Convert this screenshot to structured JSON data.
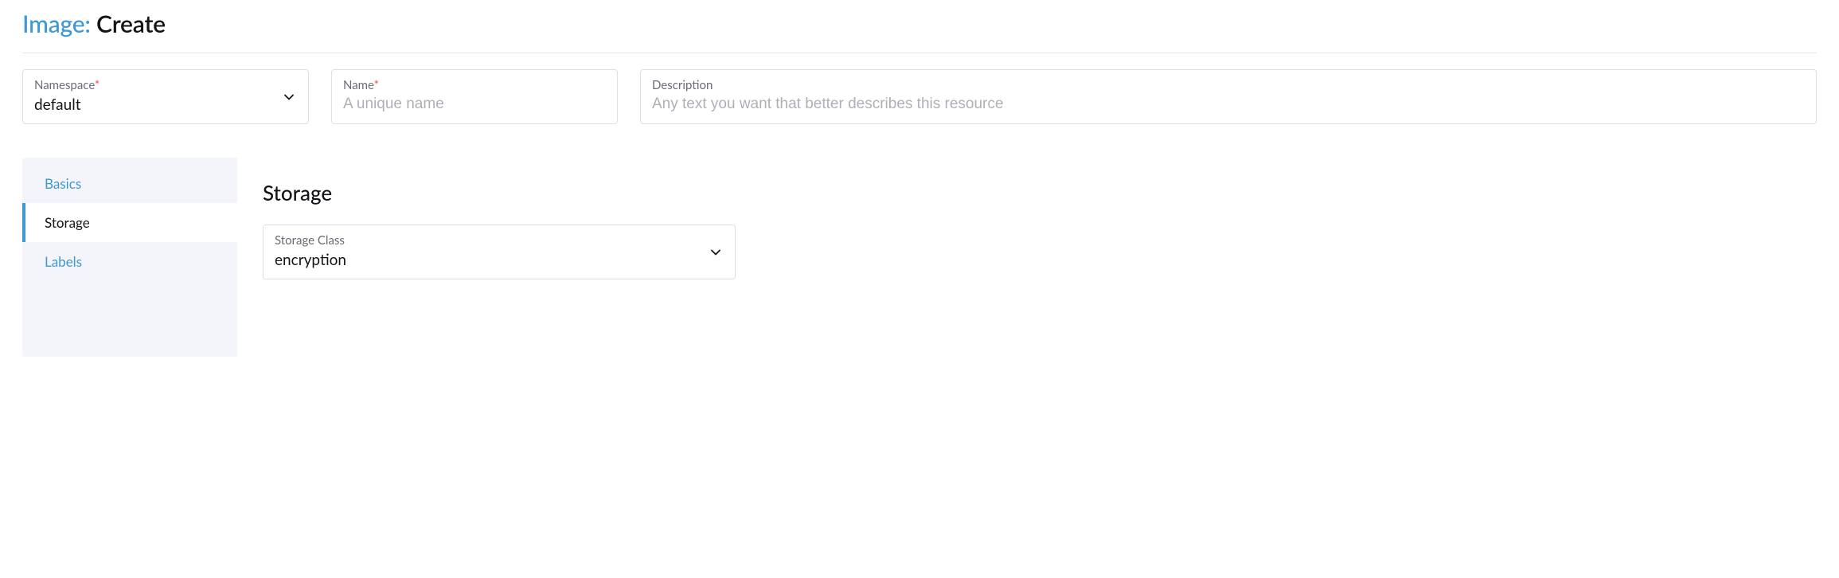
{
  "header": {
    "prefix": "Image:",
    "title": "Create"
  },
  "fields": {
    "namespace": {
      "label": "Namespace",
      "required": "*",
      "value": "default"
    },
    "name": {
      "label": "Name",
      "required": "*",
      "placeholder": "A unique name",
      "value": ""
    },
    "description": {
      "label": "Description",
      "placeholder": "Any text you want that better describes this resource",
      "value": ""
    }
  },
  "tabs": {
    "items": [
      {
        "label": "Basics",
        "active": false
      },
      {
        "label": "Storage",
        "active": true
      },
      {
        "label": "Labels",
        "active": false
      }
    ]
  },
  "storage": {
    "heading": "Storage",
    "storage_class": {
      "label": "Storage Class",
      "value": "encryption"
    }
  }
}
